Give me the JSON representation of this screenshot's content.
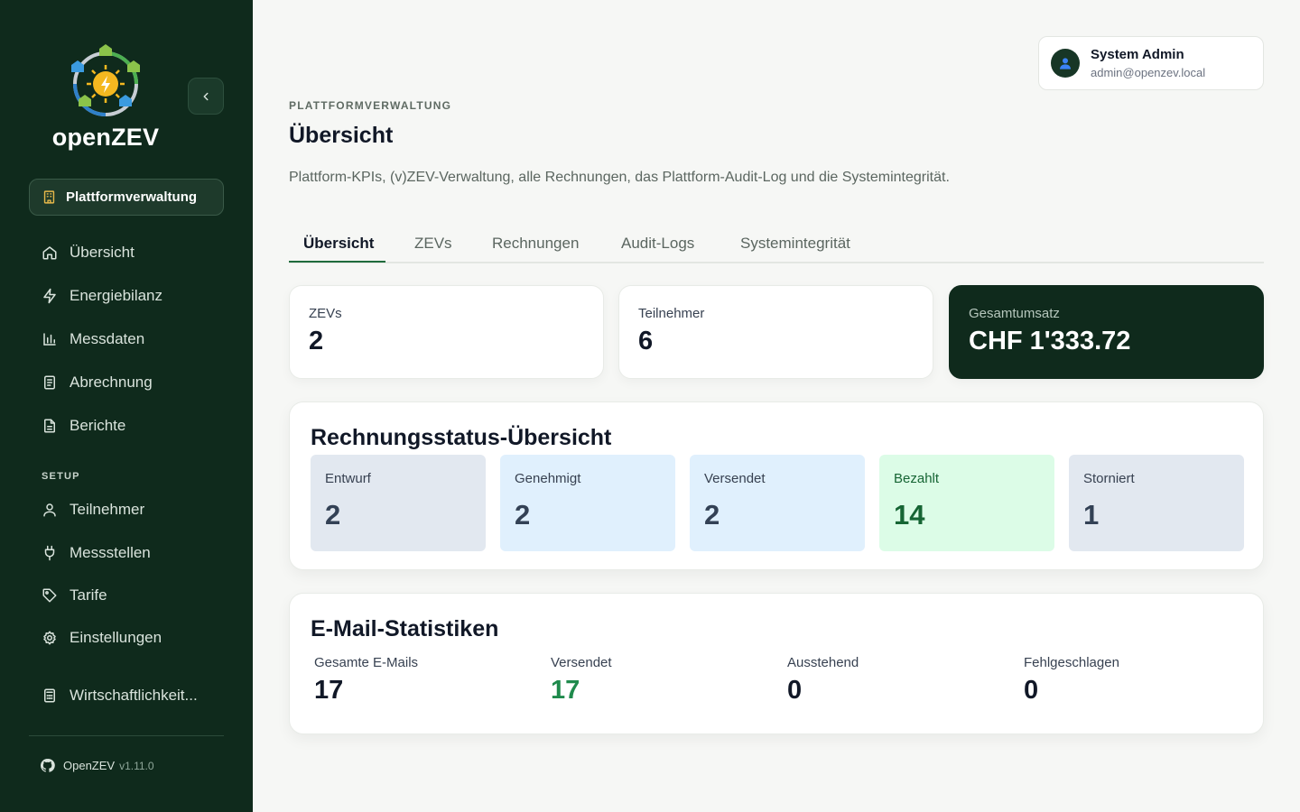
{
  "app": {
    "brand": "openZEV"
  },
  "colors": {
    "sidebar": "#0f2a1c",
    "accent": "#1f6b3c",
    "success": "#1f8a4c",
    "draft": "#e2e8f0",
    "approved": "#e0f0fd",
    "sent": "#e0f0fd",
    "paid": "#dcfce7",
    "cancelled": "#e2e8f0"
  },
  "sidebar": {
    "collapse_icon": "chevron-left-icon",
    "active_section": {
      "label": "Plattformverwaltung",
      "icon": "building-icon"
    },
    "items": [
      {
        "label": "Übersicht",
        "icon": "home-icon"
      },
      {
        "label": "Energiebilanz",
        "icon": "lightning-icon"
      },
      {
        "label": "Messdaten",
        "icon": "bar-chart-icon"
      },
      {
        "label": "Abrechnung",
        "icon": "document-icon"
      },
      {
        "label": "Berichte",
        "icon": "report-icon"
      }
    ],
    "setup_label": "SETUP",
    "setup_items": [
      {
        "label": "Teilnehmer",
        "icon": "users-icon"
      },
      {
        "label": "Messstellen",
        "icon": "plug-icon"
      },
      {
        "label": "Tarife",
        "icon": "tag-icon"
      },
      {
        "label": "Einstellungen",
        "icon": "gear-icon"
      }
    ],
    "extra_item": {
      "label": "Wirtschaftlichkeit...",
      "icon": "calculator-icon"
    },
    "footer": {
      "name": "OpenZEV",
      "version": "v1.11.0",
      "icon": "github-icon"
    }
  },
  "user": {
    "name": "System Admin",
    "email": "admin@openzev.local",
    "icon": "user-icon"
  },
  "header": {
    "eyebrow": "PLATTFORMVERWALTUNG",
    "title": "Übersicht",
    "description": "Plattform-KPIs, (v)ZEV-Verwaltung, alle Rechnungen, das Plattform-Audit-Log und die Systemintegrität."
  },
  "tabs": [
    {
      "label": "Übersicht",
      "active": true
    },
    {
      "label": "ZEVs"
    },
    {
      "label": "Rechnungen"
    },
    {
      "label": "Audit-Logs"
    },
    {
      "label": "Systemintegrität"
    }
  ],
  "kpis": [
    {
      "label": "ZEVs",
      "value": "2"
    },
    {
      "label": "Teilnehmer",
      "value": "6"
    },
    {
      "label": "Gesamtumsatz",
      "value": "CHF 1'333.72"
    }
  ],
  "invoice_status": {
    "title": "Rechnungsstatus-Übersicht",
    "items": [
      {
        "label": "Entwurf",
        "value": "2"
      },
      {
        "label": "Genehmigt",
        "value": "2"
      },
      {
        "label": "Versendet",
        "value": "2"
      },
      {
        "label": "Bezahlt",
        "value": "14"
      },
      {
        "label": "Storniert",
        "value": "1"
      }
    ]
  },
  "email_stats": {
    "title": "E-Mail-Statistiken",
    "items": [
      {
        "label": "Gesamte E-Mails",
        "value": "17"
      },
      {
        "label": "Versendet",
        "value": "17"
      },
      {
        "label": "Ausstehend",
        "value": "0"
      },
      {
        "label": "Fehlgeschlagen",
        "value": "0"
      }
    ]
  }
}
